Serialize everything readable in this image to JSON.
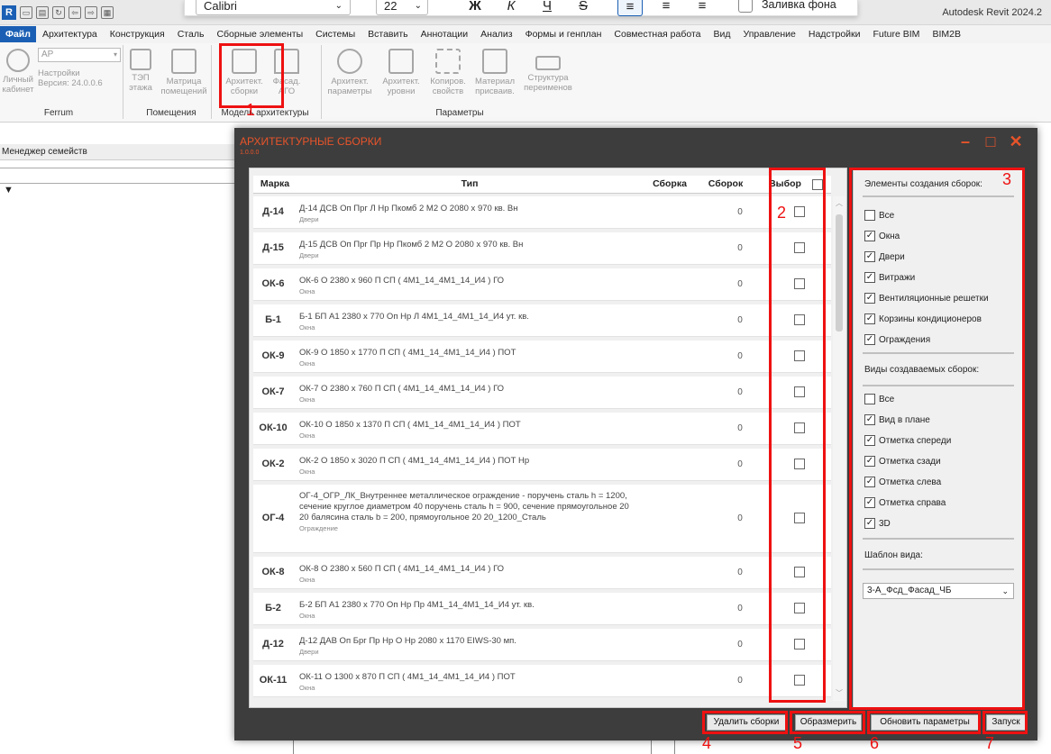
{
  "app": {
    "title": "Autodesk Revit 2024.2"
  },
  "fontbar": {
    "font": "Calibri",
    "size": "22",
    "bold": "Ж",
    "italic": "К",
    "underline": "Ч",
    "strike": "S",
    "fill_label": "Заливка фона"
  },
  "menu": [
    "Файл",
    "Архитектура",
    "Конструкция",
    "Сталь",
    "Сборные элементы",
    "Системы",
    "Вставить",
    "Аннотации",
    "Анализ",
    "Формы и генплан",
    "Совместная работа",
    "Вид",
    "Управление",
    "Надстройки",
    "Future BIM",
    "BIM2B"
  ],
  "ribbon": {
    "ar_combo": "АР",
    "buttons": [
      {
        "l1": "Личный",
        "l2": "кабинет"
      },
      {
        "l1": "Настройки",
        "l2": "Версия: 24.0.0.6"
      },
      {
        "l1": "ТЭП",
        "l2": "этажа"
      },
      {
        "l1": "Матрица",
        "l2": "помещений"
      },
      {
        "l1": "Архитект.",
        "l2": "сборки"
      },
      {
        "l1": "Фасад.",
        "l2": "АГО"
      },
      {
        "l1": "Архитект.",
        "l2": "параметры"
      },
      {
        "l1": "Архитект.",
        "l2": "уровни"
      },
      {
        "l1": "Копиров.",
        "l2": "свойств"
      },
      {
        "l1": "Материал",
        "l2": "присваив."
      },
      {
        "l1": "Структура",
        "l2": "переименов"
      }
    ],
    "groups": [
      "Ferrum",
      "Помещения",
      "Модель архитектуры",
      "Параметры"
    ]
  },
  "left": {
    "header": "Менеджер семейств",
    "tree_arrow": "▼"
  },
  "dialog": {
    "title": "АРХИТЕКТУРНЫЕ СБОРКИ",
    "version": "1.0.0.0",
    "cols": {
      "mark": "Марка",
      "type": "Тип",
      "assembly": "Сборка",
      "count": "Сборок",
      "select": "Выбор"
    },
    "rows": [
      {
        "mark": "Д-14",
        "type": "Д-14 ДСВ Оп Прг Л Нр Пкомб 2 М2 О 2080 х 970 кв. Вн",
        "cat": "Двери",
        "count": "0"
      },
      {
        "mark": "Д-15",
        "type": "Д-15 ДСВ Оп Прг Пр Нр Пкомб 2 М2 О 2080 х 970 кв. Вн",
        "cat": "Двери",
        "count": "0"
      },
      {
        "mark": "ОК-6",
        "type": "ОК-6 О 2380 х 960 П СП ( 4М1_14_4М1_14_И4 )  ГО",
        "cat": "Окна",
        "count": "0"
      },
      {
        "mark": "Б-1",
        "type": "Б-1 БП А1 2380 х 770 Оп Нр Л 4М1_14_4М1_14_И4 ут. кв.",
        "cat": "Окна",
        "count": "0"
      },
      {
        "mark": "ОК-9",
        "type": "ОК-9 О 1850 х 1770 П СП ( 4М1_14_4М1_14_И4 )  ПОТ",
        "cat": "Окна",
        "count": "0"
      },
      {
        "mark": "ОК-7",
        "type": "ОК-7 О 2380 х 760 П СП ( 4М1_14_4М1_14_И4 )  ГО",
        "cat": "Окна",
        "count": "0"
      },
      {
        "mark": "ОК-10",
        "type": "ОК-10 О 1850 х 1370 П СП ( 4М1_14_4М1_14_И4 )  ПОТ",
        "cat": "Окна",
        "count": "0"
      },
      {
        "mark": "ОК-2",
        "type": "ОК-2 О 1850 х 3020 П СП ( 4М1_14_4М1_14_И4 )  ПОТ Нр",
        "cat": "Окна",
        "count": "0"
      },
      {
        "mark": "ОГ-4",
        "type": "ОГ-4_ОГР_ЛК_Внутреннее металлическое ограждение - поручень сталь h = 1200, сечение круглое диаметром 40 поручень сталь h = 900, сечение прямоугольное 20  20 балясина сталь b = 200, прямоугольное 20 20_1200_Сталь",
        "cat": "Ограждение",
        "count": "0"
      },
      {
        "mark": "ОК-8",
        "type": "ОК-8 О 2380 х 560 П СП ( 4М1_14_4М1_14_И4 )  ГО",
        "cat": "Окна",
        "count": "0"
      },
      {
        "mark": "Б-2",
        "type": "Б-2 БП А1 2380 х 770 Оп Нр Пр 4М1_14_4М1_14_И4 ут. кв.",
        "cat": "Окна",
        "count": "0"
      },
      {
        "mark": "Д-12",
        "type": "Д-12 ДАВ Оп Брг Пр Нр О Нр 2080 х 1170 EIWS-30 мп.",
        "cat": "Двери",
        "count": "0"
      },
      {
        "mark": "ОК-11",
        "type": "ОК-11 О 1300 х 870 П СП ( 4М1_14_4М1_14_И4 )  ПОТ",
        "cat": "Окна",
        "count": "0"
      }
    ],
    "side": {
      "elements_title": "Элементы создания сборок:",
      "elements": [
        {
          "label": "Все",
          "checked": false
        },
        {
          "label": "Окна",
          "checked": true
        },
        {
          "label": "Двери",
          "checked": true
        },
        {
          "label": "Витражи",
          "checked": true
        },
        {
          "label": "Вентиляционные решетки",
          "checked": true
        },
        {
          "label": "Корзины кондиционеров",
          "checked": true
        },
        {
          "label": "Ограждения",
          "checked": true
        }
      ],
      "views_title": "Виды создаваемых сборок:",
      "views": [
        {
          "label": "Все",
          "checked": false
        },
        {
          "label": "Вид в плане",
          "checked": true
        },
        {
          "label": "Отметка спереди",
          "checked": true
        },
        {
          "label": "Отметка сзади",
          "checked": true
        },
        {
          "label": "Отметка слева",
          "checked": true
        },
        {
          "label": "Отметка справа",
          "checked": true
        },
        {
          "label": "3D",
          "checked": true
        }
      ],
      "template_title": "Шаблон вида:",
      "template_value": "3-А_Фсд_Фасад_ЧБ"
    },
    "buttons": {
      "delete": "Удалить сборки",
      "dimension": "Образмерить",
      "update": "Обновить параметры",
      "run": "Запуск"
    }
  },
  "markers": {
    "m1": "1",
    "m2": "2",
    "m3": "3",
    "m4": "4",
    "m5": "5",
    "m6": "6",
    "m7": "7"
  }
}
